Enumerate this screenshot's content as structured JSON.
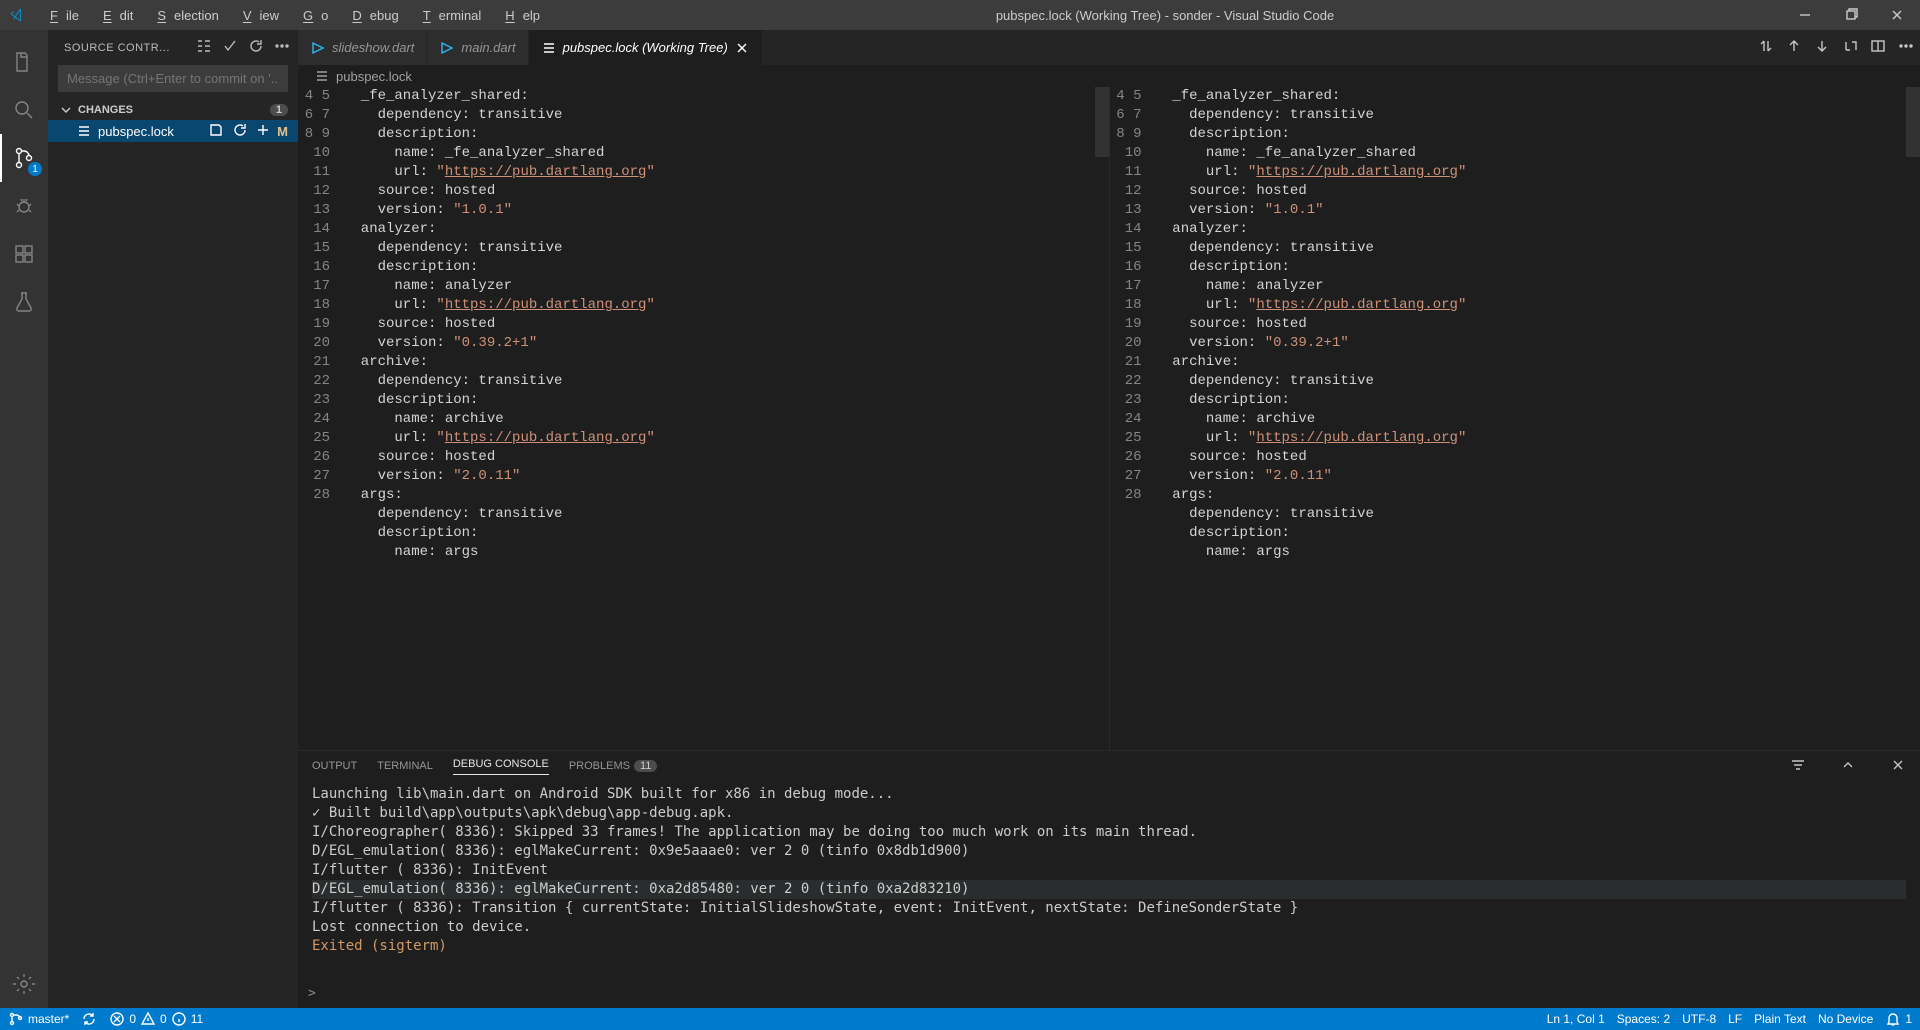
{
  "title": "pubspec.lock (Working Tree) - sonder - Visual Studio Code",
  "menu": [
    "File",
    "Edit",
    "Selection",
    "View",
    "Go",
    "Debug",
    "Terminal",
    "Help"
  ],
  "sidebar_title": "SOURCE CONTR...",
  "scm_placeholder": "Message (Ctrl+Enter to commit on '...",
  "changes_label": "CHANGES",
  "changes_count": "1",
  "changed_file": "pubspec.lock",
  "changed_badge": "M",
  "scm_badge": "1",
  "tabs": [
    "slideshow.dart",
    "main.dart",
    "pubspec.lock (Working Tree)"
  ],
  "breadcrumb": "pubspec.lock",
  "line_start": 4,
  "code_lines": [
    "  _fe_analyzer_shared:",
    "    dependency: transitive",
    "    description:",
    "      name: _fe_analyzer_shared",
    "      url: \"https://pub.dartlang.org\"",
    "    source: hosted",
    "    version: \"1.0.1\"",
    "  analyzer:",
    "    dependency: transitive",
    "    description:",
    "      name: analyzer",
    "      url: \"https://pub.dartlang.org\"",
    "    source: hosted",
    "    version: \"0.39.2+1\"",
    "  archive:",
    "    dependency: transitive",
    "    description:",
    "      name: archive",
    "      url: \"https://pub.dartlang.org\"",
    "    source: hosted",
    "    version: \"2.0.11\"",
    "  args:",
    "    dependency: transitive",
    "    description:",
    "      name: args"
  ],
  "panels": {
    "output": "OUTPUT",
    "terminal": "TERMINAL",
    "debug": "DEBUG CONSOLE",
    "problems": "PROBLEMS",
    "problems_count": "11"
  },
  "console": [
    "Launching lib\\main.dart on Android SDK built for x86 in debug mode...",
    "✓ Built build\\app\\outputs\\apk\\debug\\app-debug.apk.",
    "I/Choreographer( 8336): Skipped 33 frames!  The application may be doing too much work on its main thread.",
    "D/EGL_emulation( 8336): eglMakeCurrent: 0x9e5aaae0: ver 2 0 (tinfo 0x8db1d900)",
    "I/flutter ( 8336): InitEvent",
    "D/EGL_emulation( 8336): eglMakeCurrent: 0xa2d85480: ver 2 0 (tinfo 0xa2d83210)",
    "I/flutter ( 8336): Transition { currentState: InitialSlideshowState, event: InitEvent, nextState: DefineSonderState }",
    "Lost connection to device."
  ],
  "console_exit": "Exited (sigterm)",
  "status": {
    "branch": "master*",
    "errors": "0",
    "warnings": "0",
    "info": "11",
    "pos": "Ln 1, Col 1",
    "spaces": "Spaces: 2",
    "enc": "UTF-8",
    "eol": "LF",
    "lang": "Plain Text",
    "device": "No Device",
    "bell": "1"
  }
}
